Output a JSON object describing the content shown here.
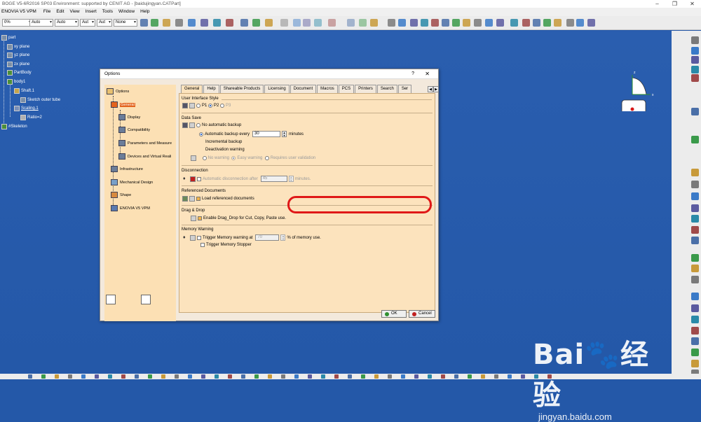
{
  "window": {
    "title": "BOGE V5-6R2016 SP03 Environment: supported by CENIT AG - [baidujingyan.CATPart]"
  },
  "menu": [
    "ENOVIA V5 VPM",
    "File",
    "Edit",
    "View",
    "Insert",
    "Tools",
    "Window",
    "Help"
  ],
  "toolbar": {
    "zoom": "0%",
    "combo2": "Auto",
    "combo3": "Auto",
    "combo4": "Aut",
    "combo5": "Aut",
    "combo6": "None"
  },
  "tree": [
    {
      "label": "part"
    },
    {
      "label": "xy plane"
    },
    {
      "label": "yz plane"
    },
    {
      "label": "zx plane"
    },
    {
      "label": "PartBody"
    },
    {
      "label": "body1"
    },
    {
      "label": "Shaft.1"
    },
    {
      "label": "Sketch outer tube"
    },
    {
      "label": "Scaling.1"
    },
    {
      "label": "Ratio=2"
    },
    {
      "label": "#Skeleton"
    }
  ],
  "compass": {
    "z": "z",
    "x": "x"
  },
  "dialog": {
    "title": "Options",
    "help": "?",
    "close": "✕",
    "categories": [
      "Options",
      "General",
      "Display",
      "Compatibility",
      "Parameters and Measure",
      "Devices and Virtual Reali",
      "Infrastructure",
      "Mechanical Design",
      "Shape",
      "ENOVIA V5 VPM"
    ],
    "tabs": [
      "General",
      "Help",
      "Shareable Products",
      "Licensing",
      "Document",
      "Macros",
      "PCS",
      "Printers",
      "Search",
      "Ser"
    ],
    "ui_style": {
      "heading": "User Interface Style",
      "p1": "P1",
      "p2": "P2",
      "p3": "P3"
    },
    "data_save": {
      "heading": "Data Save",
      "no_auto": "No automatic backup",
      "auto_label": "Automatic backup every",
      "auto_value": "30",
      "auto_unit": "minutes",
      "incremental": "Incremental backup",
      "deact": "Deactivation warning",
      "no_warning": "No warning",
      "easy_warning": "Easy warning",
      "requires": "Requires user validation"
    },
    "disconnection": {
      "heading": "Disconnection",
      "label": "Automatic disconnection after",
      "value": "45",
      "unit": "minutes."
    },
    "referenced": {
      "heading": "Referenced Documents",
      "label": "Load referenced documents"
    },
    "drag": {
      "heading": "Drag & Drop",
      "label": "Enable Drag_Drop for Cut, Copy, Paste use."
    },
    "memory": {
      "heading": "Memory Warning",
      "label": "Trigger Memory warning at",
      "value": "70",
      "unit": "% of memory use.",
      "stopper": "Trigger Memory Stopper"
    },
    "ok": "OK",
    "cancel": "Cancel"
  },
  "watermark": {
    "brand": "Bai",
    "brand2": "经验",
    "url": "jingyan.baidu.com"
  }
}
